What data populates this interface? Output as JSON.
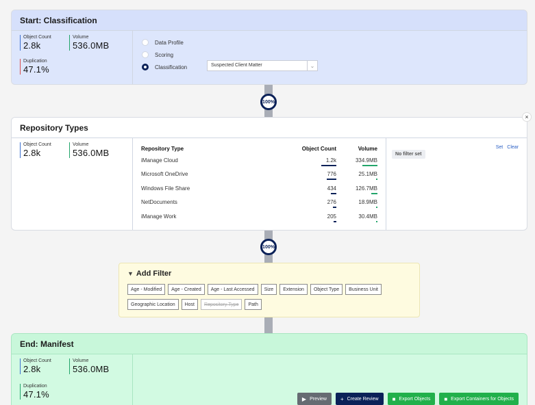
{
  "start": {
    "title": "Start: Classification",
    "object_count_label": "Object Count",
    "object_count": "2.8k",
    "volume_label": "Volume",
    "volume": "536.0MB",
    "duplication_label": "Duplication",
    "duplication": "47.1%",
    "radios": [
      "Data Profile",
      "Scoring",
      "Classification"
    ],
    "selected_radio": "Classification",
    "select_value": "Suspected Client Matter"
  },
  "connector1": {
    "percent": "100%"
  },
  "connector2": {
    "percent": "100%"
  },
  "repo": {
    "title": "Repository Types",
    "object_count_label": "Object Count",
    "object_count": "2.8k",
    "volume_label": "Volume",
    "volume": "536.0MB",
    "columns": [
      "Repository Type",
      "Object Count",
      "Volume"
    ],
    "rows": [
      {
        "name": "iManage Cloud",
        "count": "1.2k",
        "volume": "334.9MB"
      },
      {
        "name": "Microsoft OneDrive",
        "count": "776",
        "volume": "25.1MB"
      },
      {
        "name": "Windows File Share",
        "count": "434",
        "volume": "126.7MB"
      },
      {
        "name": "NetDocuments",
        "count": "276",
        "volume": "18.9MB"
      },
      {
        "name": "iManage Work",
        "count": "205",
        "volume": "30.4MB"
      }
    ],
    "no_filter": "No filter set",
    "set_label": "Set",
    "clear_label": "Clear",
    "close_label": "×"
  },
  "add_filter": {
    "title": "Add Filter",
    "chips": [
      "Age - Modified",
      "Age - Created",
      "Age - Last Accessed",
      "Size",
      "Extension",
      "Object Type",
      "Business Unit",
      "Geographic Location",
      "Host",
      "Repository Type",
      "Path"
    ],
    "disabled_chip": "Repository Type"
  },
  "end": {
    "title": "End: Manifest",
    "object_count_label": "Object Count",
    "object_count": "2.8k",
    "volume_label": "Volume",
    "volume": "536.0MB",
    "duplication_label": "Duplication",
    "duplication": "47.1%",
    "preview_label": "Preview",
    "create_review_label": "Create Review",
    "export_objects_label": "Export Objects",
    "export_containers_label": "Export Containers for Objects"
  },
  "colors": {
    "navy": "#0b2158",
    "green": "#21b04b",
    "start_bg": "#d6e0fb",
    "end_bg": "#c8f7da"
  }
}
